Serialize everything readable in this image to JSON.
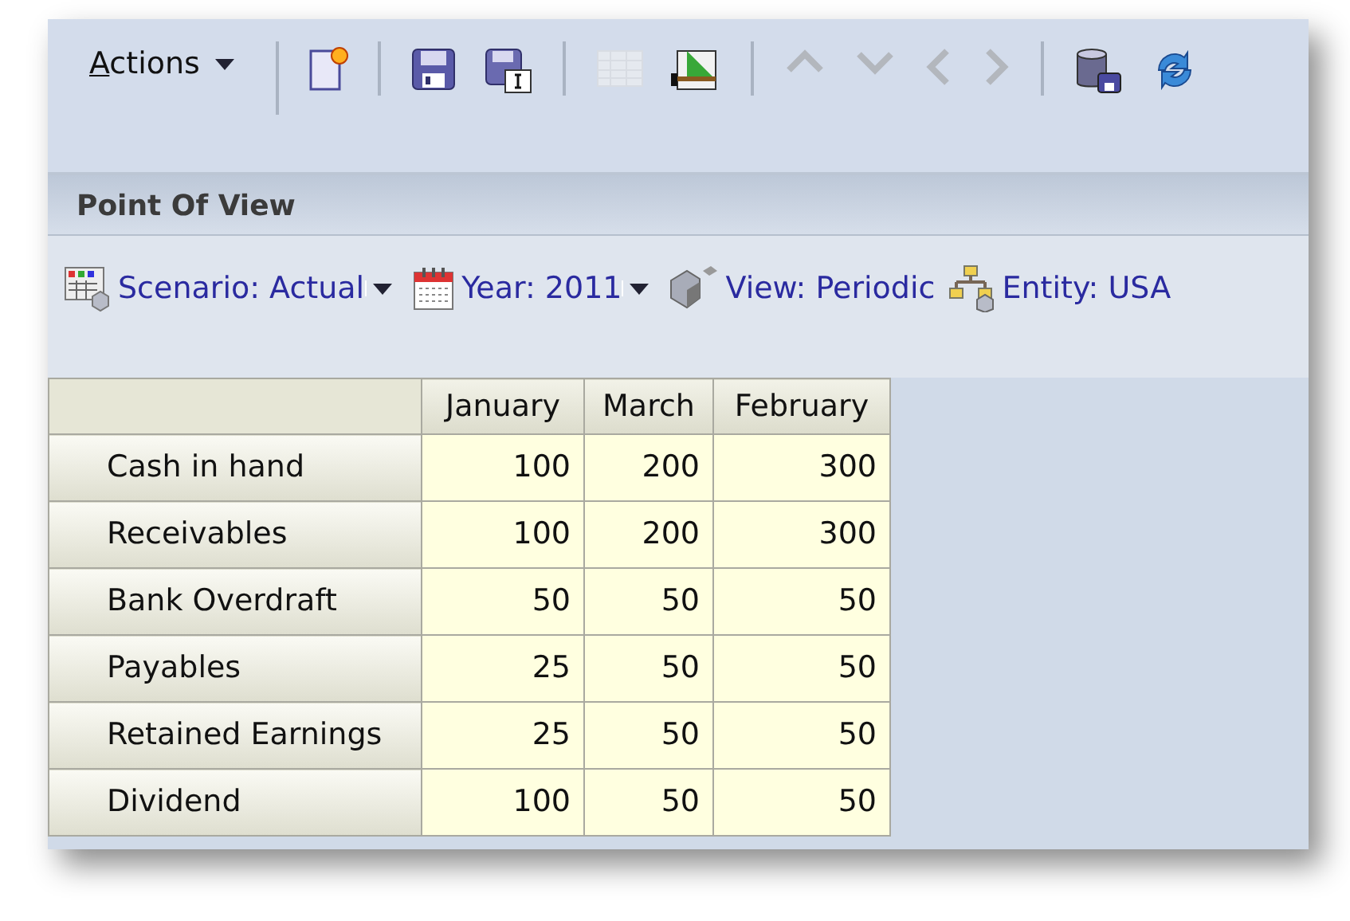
{
  "toolbar": {
    "actions_label": "Actions",
    "items": [
      {
        "kind": "separator"
      },
      {
        "kind": "new-document",
        "disabled": false
      },
      {
        "kind": "separator"
      },
      {
        "kind": "save",
        "disabled": false
      },
      {
        "kind": "save-as",
        "disabled": false
      },
      {
        "kind": "separator"
      },
      {
        "kind": "grid",
        "disabled": true
      },
      {
        "kind": "chart",
        "disabled": false
      },
      {
        "kind": "separator"
      },
      {
        "kind": "up",
        "disabled": true
      },
      {
        "kind": "down",
        "disabled": true
      },
      {
        "kind": "left",
        "disabled": true
      },
      {
        "kind": "right",
        "disabled": true
      },
      {
        "kind": "separator"
      },
      {
        "kind": "database",
        "disabled": false
      },
      {
        "kind": "refresh",
        "disabled": false
      }
    ]
  },
  "point_of_view": {
    "title": "Point Of View",
    "members": [
      {
        "kind": "scenario",
        "label": "Scenario: Actual",
        "dropdown": true
      },
      {
        "kind": "calendar",
        "label": "Year: 2011",
        "dropdown": true
      },
      {
        "kind": "cube",
        "label": "View: Periodic",
        "dropdown": false
      },
      {
        "kind": "hierarchy",
        "label": "Entity: USA",
        "dropdown": false
      }
    ]
  },
  "grid": {
    "columns": [
      "January",
      "March",
      "February"
    ],
    "rows": [
      {
        "label": "Cash in hand",
        "values": [
          "100",
          "200",
          "300"
        ]
      },
      {
        "label": "Receivables",
        "values": [
          "100",
          "200",
          "300"
        ]
      },
      {
        "label": "Bank Overdraft",
        "values": [
          "50",
          "50",
          "50"
        ]
      },
      {
        "label": "Payables",
        "values": [
          "25",
          "50",
          "50"
        ]
      },
      {
        "label": "Retained Earnings",
        "values": [
          "25",
          "50",
          "50"
        ]
      },
      {
        "label": "Dividend",
        "values": [
          "100",
          "50",
          "50"
        ]
      }
    ]
  }
}
